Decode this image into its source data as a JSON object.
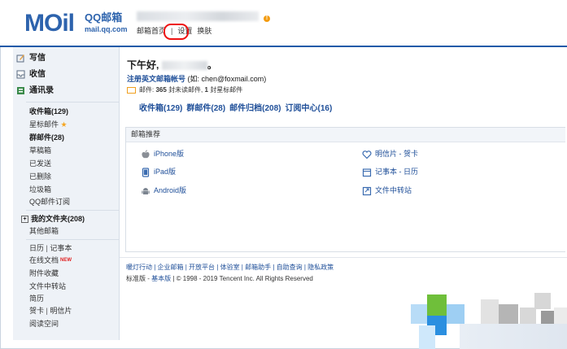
{
  "header": {
    "logo_mail": "MOil",
    "logo_qq": "QQ邮箱",
    "logo_url": "mail.qq.com",
    "warn_glyph": "!",
    "nav": [
      "邮箱首页",
      "设置",
      "换肤"
    ],
    "nav_sep": "|"
  },
  "sidebar": {
    "write": "写信",
    "receive": "收信",
    "contacts": "通讯录",
    "inbox": "收件箱(129)",
    "starred": "星标邮件",
    "group": "群邮件(28)",
    "drafts": "草稿箱",
    "sent": "已发送",
    "deleted": "已删除",
    "trash": "垃圾箱",
    "subscriptions": "QQ邮件订阅",
    "my_folders": "我的文件夹(208)",
    "other_mailbox": "其他邮箱",
    "calendar": "日历",
    "sep": "|",
    "notebook": "记事本",
    "online_docs": "在线文档",
    "new_badge": "NEW",
    "attachments": "附件收藏",
    "file_transfer": "文件中转站",
    "resume": "简历",
    "greeting_card": "贺卡",
    "postcard": "明信片",
    "reading_space": "阅读空间"
  },
  "main": {
    "greeting": "下午好,",
    "greeting_end": "。",
    "acct_label": "注册英文邮箱帐号",
    "acct_hint": "(如: chen@foxmail.com)",
    "mail_label": "邮件:",
    "unread_count": "365",
    "unread_label": "封未读邮件,",
    "star_count": "1",
    "star_label": "封星标邮件",
    "folders": [
      "收件箱(129)",
      "群邮件(28)",
      "邮件归档(208)",
      "订阅中心(16)"
    ],
    "rec_title": "邮箱推荐",
    "rec_left": [
      "iPhone版",
      "iPad版",
      "Android版"
    ],
    "rec_right": [
      "明信片 - 贺卡",
      "记事本 - 日历",
      "文件中转站"
    ],
    "footer_links": "暖灯行动 | 企业邮箱 | 开放平台 | 体验室 | 邮箱助手 | 自助查询 | 隐私政策",
    "footer_std": "标准版 - ",
    "footer_basic": "基本版",
    "footer_copy": " | © 1998 - 2019 Tencent Inc. All Rights Reserved"
  },
  "colors": {
    "brand": "#2d63ad",
    "link": "#1f4f99",
    "highlight_circle": "#e11111",
    "star": "#f5a623"
  }
}
